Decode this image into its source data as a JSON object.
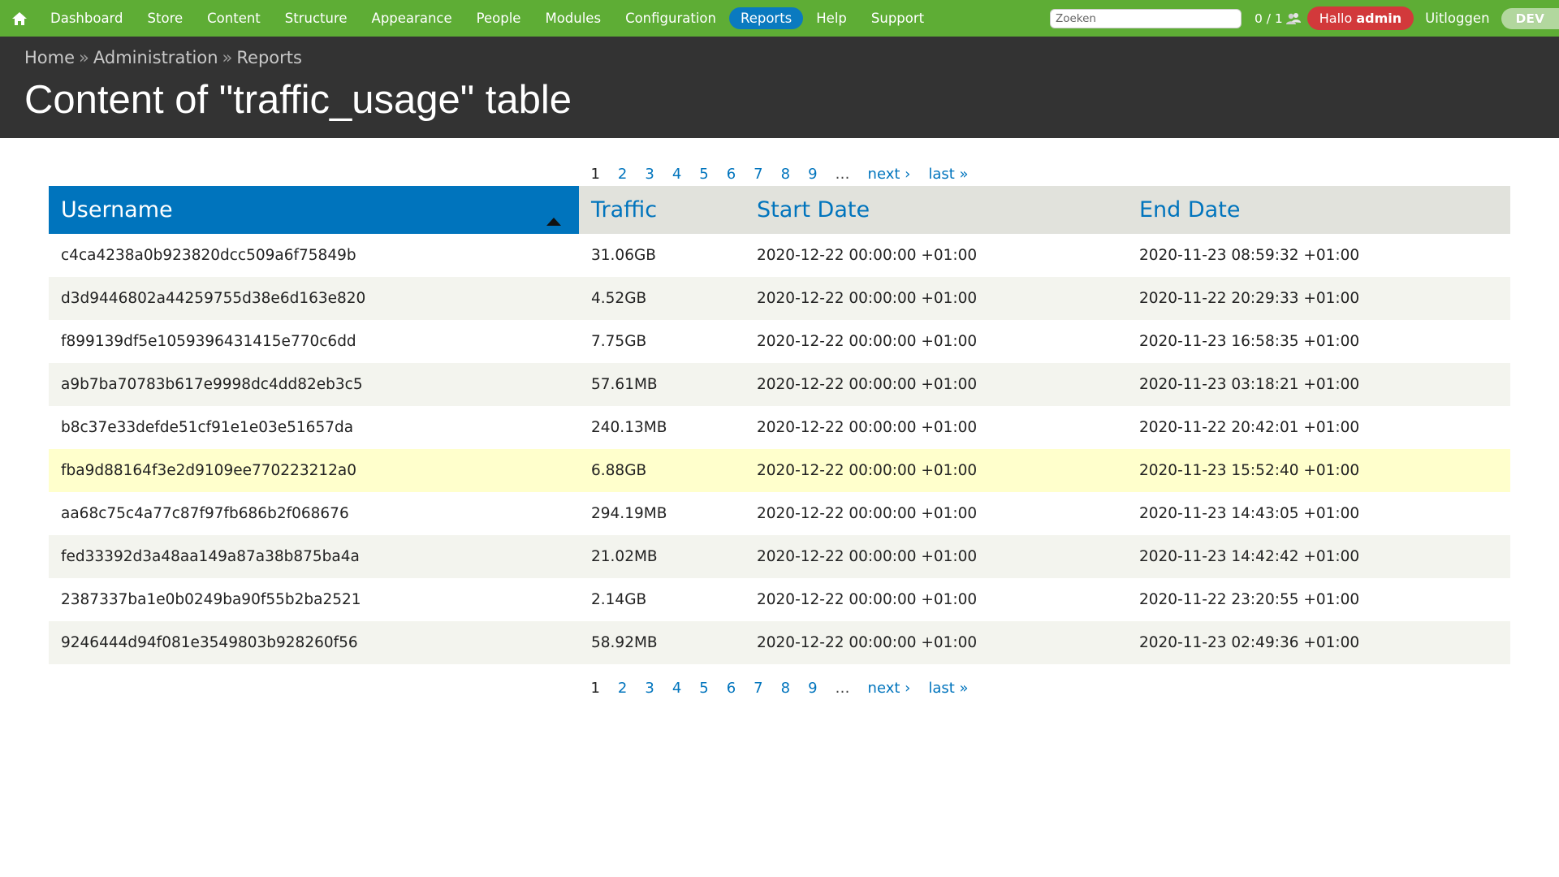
{
  "toolbar": {
    "nav": [
      "Dashboard",
      "Store",
      "Content",
      "Structure",
      "Appearance",
      "People",
      "Modules",
      "Configuration",
      "Reports",
      "Help",
      "Support"
    ],
    "active_index": 8,
    "search_placeholder": "Zoeken",
    "counter": "0 / 1",
    "hello_prefix": "Hallo",
    "hello_user": "admin",
    "logout": "Uitloggen",
    "env": "DEV",
    "colors": {
      "bar": "#5ead35",
      "active": "#0a7ac0",
      "hello": "#d2393b",
      "env": "#b2d79e"
    }
  },
  "breadcrumb": [
    "Home",
    "Administration",
    "Reports"
  ],
  "breadcrumb_sep": "»",
  "page_title": "Content of \"traffic_usage\" table",
  "pager": {
    "pages": [
      "1",
      "2",
      "3",
      "4",
      "5",
      "6",
      "7",
      "8",
      "9"
    ],
    "current": "1",
    "ellipsis": "…",
    "next": "next ›",
    "last": "last »"
  },
  "table": {
    "headers": [
      "Username",
      "Traffic",
      "Start Date",
      "End Date"
    ],
    "sorted_column": 0,
    "sort_direction": "ascending",
    "highlight_row": 5,
    "rows": [
      [
        "c4ca4238a0b923820dcc509a6f75849b",
        "31.06GB",
        "2020-12-22 00:00:00 +01:00",
        "2020-11-23 08:59:32 +01:00"
      ],
      [
        "d3d9446802a44259755d38e6d163e820",
        "4.52GB",
        "2020-12-22 00:00:00 +01:00",
        "2020-11-22 20:29:33 +01:00"
      ],
      [
        "f899139df5e1059396431415e770c6dd",
        "7.75GB",
        "2020-12-22 00:00:00 +01:00",
        "2020-11-23 16:58:35 +01:00"
      ],
      [
        "a9b7ba70783b617e9998dc4dd82eb3c5",
        "57.61MB",
        "2020-12-22 00:00:00 +01:00",
        "2020-11-23 03:18:21 +01:00"
      ],
      [
        "b8c37e33defde51cf91e1e03e51657da",
        "240.13MB",
        "2020-12-22 00:00:00 +01:00",
        "2020-11-22 20:42:01 +01:00"
      ],
      [
        "fba9d88164f3e2d9109ee770223212a0",
        "6.88GB",
        "2020-12-22 00:00:00 +01:00",
        "2020-11-23 15:52:40 +01:00"
      ],
      [
        "aa68c75c4a77c87f97fb686b2f068676",
        "294.19MB",
        "2020-12-22 00:00:00 +01:00",
        "2020-11-23 14:43:05 +01:00"
      ],
      [
        "fed33392d3a48aa149a87a38b875ba4a",
        "21.02MB",
        "2020-12-22 00:00:00 +01:00",
        "2020-11-23 14:42:42 +01:00"
      ],
      [
        "2387337ba1e0b0249ba90f55b2ba2521",
        "2.14GB",
        "2020-12-22 00:00:00 +01:00",
        "2020-11-22 23:20:55 +01:00"
      ],
      [
        "9246444d94f081e3549803b928260f56",
        "58.92MB",
        "2020-12-22 00:00:00 +01:00",
        "2020-11-23 02:49:36 +01:00"
      ]
    ]
  }
}
